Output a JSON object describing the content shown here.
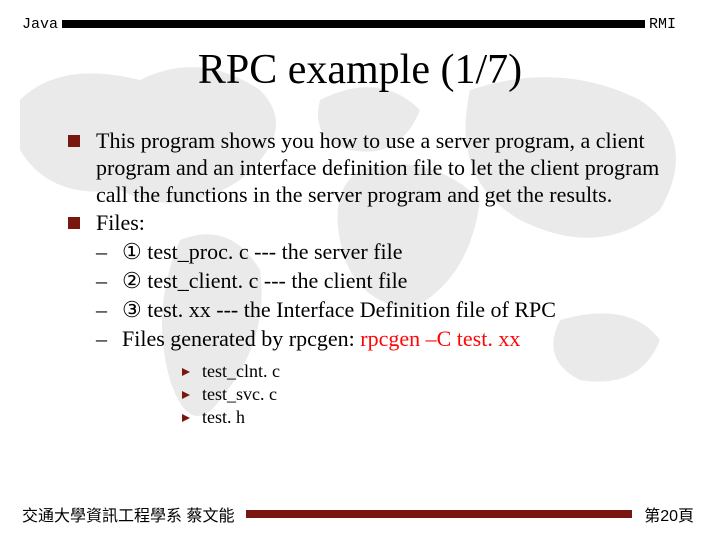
{
  "header": {
    "left": "Java",
    "right": "RMI"
  },
  "title": "RPC example  (1/7)",
  "bullets": {
    "intro": "This program shows you how to use a server program, a client program and an interface definition file to let the client program call the functions in the server program and get the results.",
    "files_label": "Files:",
    "file1": "① test_proc. c     --- the server file",
    "file2": "② test_client. c   --- the client file",
    "file3": "③ test. xx   --- the Interface Definition file of RPC",
    "gen_prefix": "Files generated by rpcgen:  ",
    "gen_cmd": "rpcgen –C test. xx",
    "gen_items": {
      "a": "test_clnt. c",
      "b": "test_svc. c",
      "c": "test. h"
    }
  },
  "footer": {
    "left": "交通大學資訊工程學系  蔡文能",
    "right": "第20頁"
  }
}
